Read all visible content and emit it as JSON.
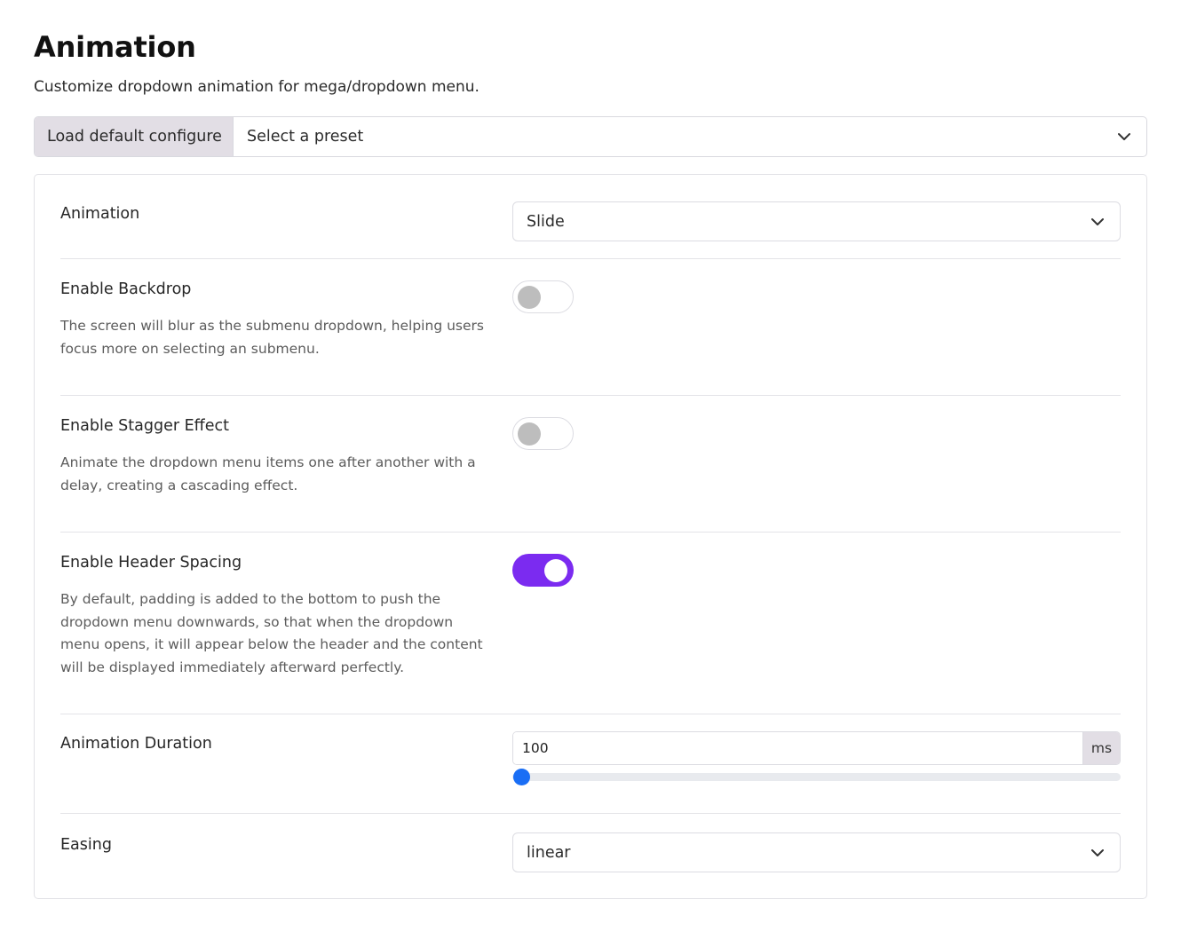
{
  "page": {
    "title": "Animation",
    "subtitle": "Customize dropdown animation for mega/dropdown menu."
  },
  "preset": {
    "load_button": "Load default configure",
    "select_value": "Select a preset"
  },
  "settings": {
    "animation": {
      "label": "Animation",
      "value": "Slide"
    },
    "backdrop": {
      "label": "Enable Backdrop",
      "description": "The screen will blur as the submenu dropdown, helping users focus more on selecting an submenu.",
      "enabled": false
    },
    "stagger": {
      "label": "Enable Stagger Effect",
      "description": "Animate the dropdown menu items one after another with a delay, creating a cascading effect.",
      "enabled": false
    },
    "header_spacing": {
      "label": "Enable Header Spacing",
      "description": "By default, padding is added to the bottom to push the dropdown menu downwards, so that when the dropdown menu opens, it will appear below the header and the content will be displayed immediately afterward perfectly.",
      "enabled": true
    },
    "duration": {
      "label": "Animation Duration",
      "value": "100",
      "unit": "ms",
      "slider_fraction": 0
    },
    "easing": {
      "label": "Easing",
      "value": "linear"
    }
  },
  "colors": {
    "toggle_on": "#7b2bf0",
    "slider_thumb": "#1a6ef5",
    "addon_bg": "#e2dee5"
  },
  "icons": {
    "select_chevron": "chevron-down-icon"
  }
}
